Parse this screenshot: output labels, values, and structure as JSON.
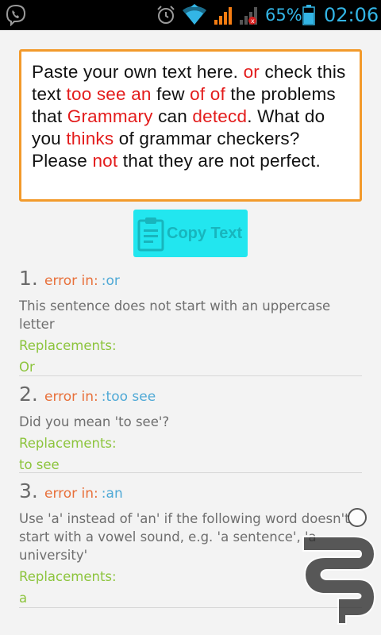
{
  "status_bar": {
    "battery_percent": "65%",
    "time": "02:06",
    "icons": [
      "viber-icon",
      "alarm-icon",
      "wifi-icon",
      "signal-icon",
      "signal-icon",
      "battery-icon"
    ],
    "accent_color": "#33b5e5"
  },
  "editor": {
    "segments": [
      {
        "text": "Paste your own text here. ",
        "error": false
      },
      {
        "text": "or",
        "error": true
      },
      {
        "text": " check this text ",
        "error": false
      },
      {
        "text": "too see an",
        "error": true
      },
      {
        "text": " few ",
        "error": false
      },
      {
        "text": "of of",
        "error": true
      },
      {
        "text": " the problems that ",
        "error": false
      },
      {
        "text": "Grammary",
        "error": true
      },
      {
        "text": " can ",
        "error": false
      },
      {
        "text": "detecd",
        "error": true
      },
      {
        "text": ". What do you ",
        "error": false
      },
      {
        "text": "thinks",
        "error": true
      },
      {
        "text": " of grammar checkers? Please ",
        "error": false
      },
      {
        "text": "not",
        "error": true
      },
      {
        "text": " that they are not perfect.",
        "error": false
      }
    ],
    "border_color": "#f29a2b",
    "error_color": "#e31c1c"
  },
  "copy_button": {
    "label": "Copy Text",
    "icon": "clipboard-icon",
    "color": "#22e6ef"
  },
  "results": [
    {
      "number": "1.",
      "error_label": "error in:",
      "error_word": ":or",
      "message": "This sentence does not start with an uppercase letter",
      "replacements_label": "Replacements:",
      "replacement": "Or"
    },
    {
      "number": "2.",
      "error_label": "error in:",
      "error_word": ":too see",
      "message": "Did you mean 'to see'?",
      "replacements_label": "Replacements:",
      "replacement": "to see"
    },
    {
      "number": "3.",
      "error_label": "error in:",
      "error_word": ":an",
      "message": "Use 'a' instead of 'an' if the following word doesn't start with a vowel sound, e.g. 'a sentence', 'a university'",
      "replacements_label": "Replacements:",
      "replacement": "a"
    }
  ],
  "colors": {
    "error_in": "#e8703a",
    "error_word": "#4fa9d6",
    "replacement": "#8cc43c",
    "message": "#6e6e6e"
  },
  "watermark": {
    "icon": "watermark-logo-icon"
  }
}
